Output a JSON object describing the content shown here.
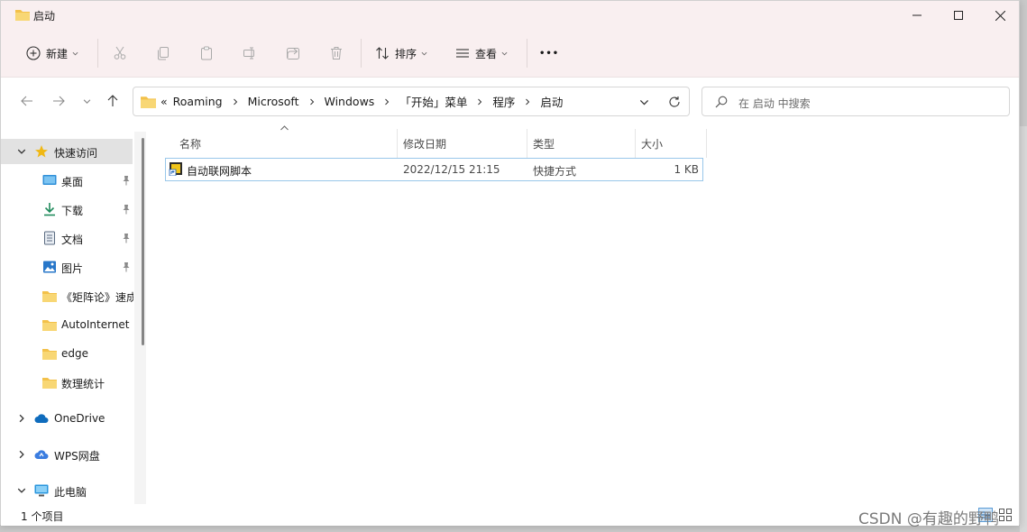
{
  "window": {
    "title": "启动",
    "controls": {
      "minimize": "minimize",
      "maximize": "maximize",
      "close": "close"
    }
  },
  "toolbar": {
    "new_label": "新建",
    "sort_label": "排序",
    "view_label": "查看",
    "icons": [
      "cut-icon",
      "copy-icon",
      "paste-icon",
      "rename-icon",
      "share-icon",
      "delete-icon"
    ],
    "more_label": "•••"
  },
  "address": {
    "overflow": "«",
    "crumbs": [
      "Roaming",
      "Microsoft",
      "Windows",
      "「开始」菜单",
      "程序",
      "启动"
    ]
  },
  "search": {
    "placeholder": "在 启动 中搜索"
  },
  "sidebar": {
    "quick_access": "快速访问",
    "items": [
      {
        "label": "桌面",
        "icon": "desktop-icon",
        "pinned": true
      },
      {
        "label": "下载",
        "icon": "download-icon",
        "pinned": true
      },
      {
        "label": "文档",
        "icon": "document-icon",
        "pinned": true
      },
      {
        "label": "图片",
        "icon": "picture-icon",
        "pinned": true
      },
      {
        "label": "《矩阵论》速成",
        "icon": "folder-icon",
        "pinned": false
      },
      {
        "label": "AutoInternet",
        "icon": "folder-icon",
        "pinned": false
      },
      {
        "label": "edge",
        "icon": "folder-icon",
        "pinned": false
      },
      {
        "label": "数理统计",
        "icon": "folder-icon",
        "pinned": false
      }
    ],
    "onedrive": "OneDrive",
    "wps": "WPS网盘",
    "thispc": "此电脑"
  },
  "columns": {
    "name": "名称",
    "date": "修改日期",
    "type": "类型",
    "size": "大小"
  },
  "files": [
    {
      "name": "自动联网脚本",
      "date": "2022/12/15 21:15",
      "type": "快捷方式",
      "size": "1 KB"
    }
  ],
  "status": {
    "count": "1 个项目"
  },
  "watermark": "CSDN @有趣的野鸭",
  "colors": {
    "chrome": "#f9eff0",
    "folder": "#f3c14a",
    "select": "#e2e2e2",
    "accent": "#0067c0"
  }
}
